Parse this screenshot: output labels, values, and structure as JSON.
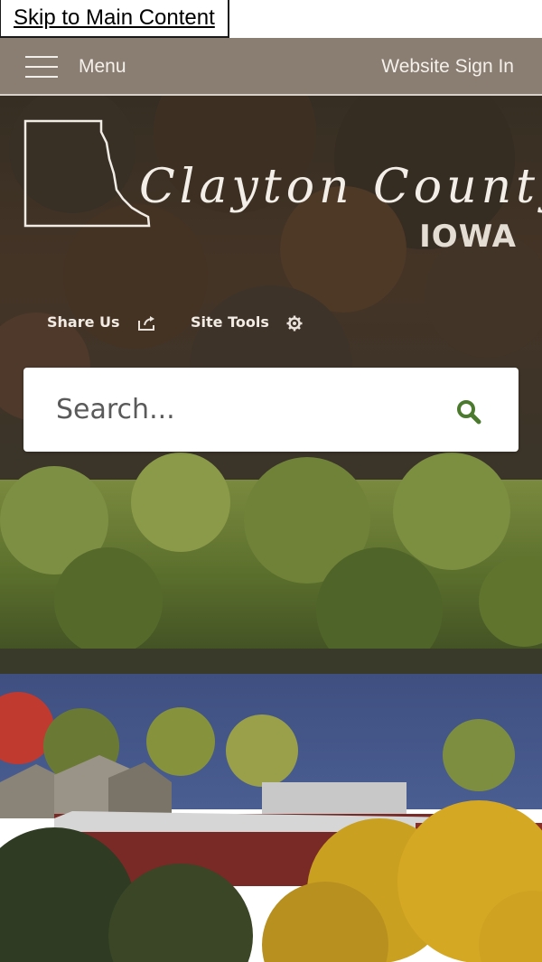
{
  "skip_link": {
    "label": "Skip to Main Content"
  },
  "header": {
    "menu_label": "Menu",
    "sign_in_label": "Website Sign In",
    "bar_color": "#8a7d72"
  },
  "logo": {
    "name": "Clayton County",
    "state": "IOWA",
    "outline_icon": "county-outline-icon"
  },
  "tools": {
    "share_label": "Share Us",
    "share_icon": "share-icon",
    "site_tools_label": "Site Tools",
    "site_tools_icon": "gear-icon"
  },
  "search": {
    "placeholder": "Search...",
    "icon": "search-icon",
    "icon_color": "#4b7a2e"
  }
}
